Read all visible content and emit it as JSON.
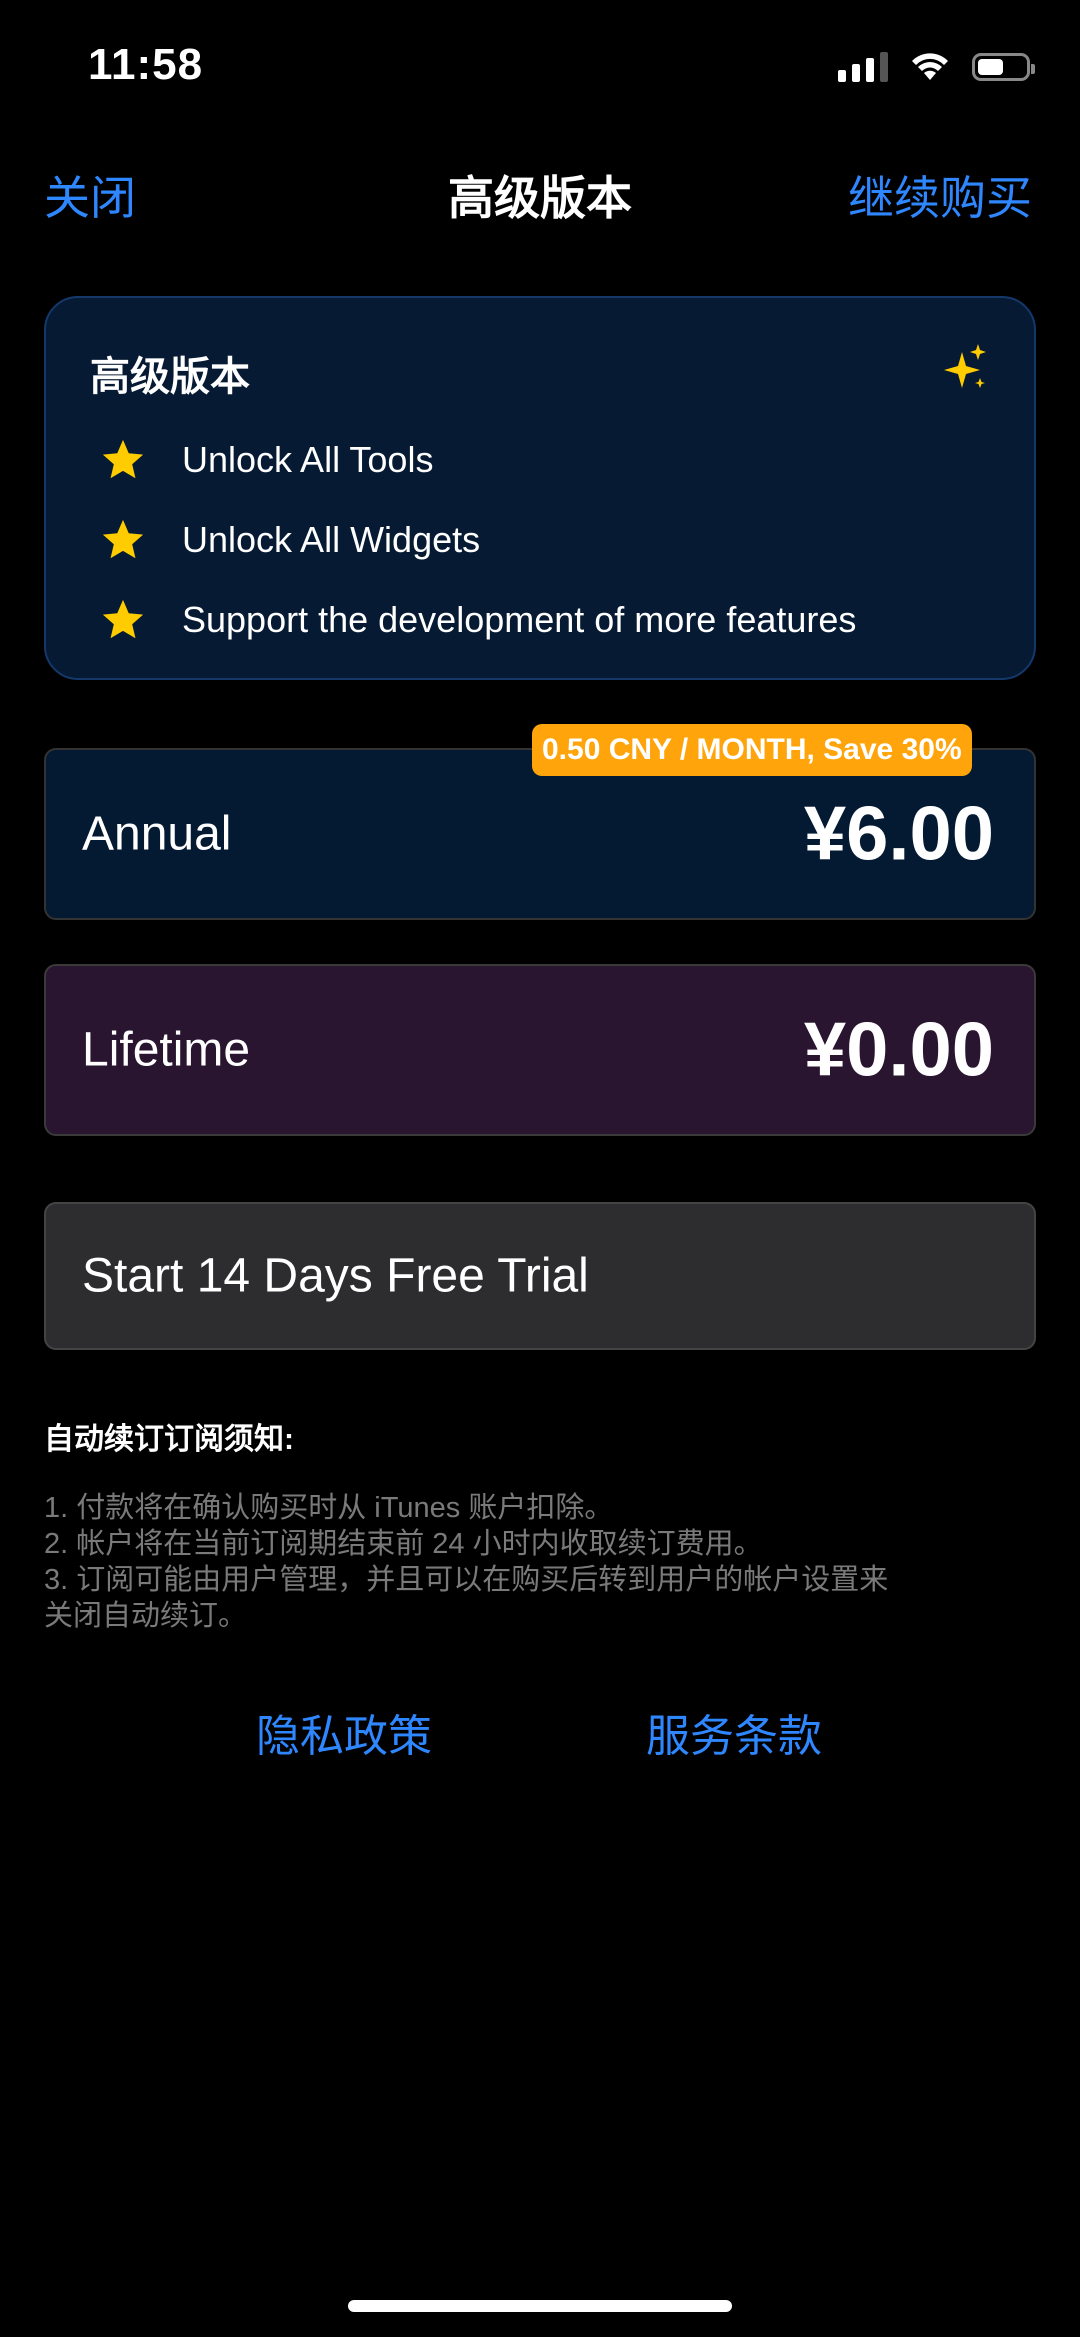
{
  "status_bar": {
    "time": "11:58",
    "battery_level": 0.55
  },
  "nav": {
    "close_label": "关闭",
    "title": "高级版本",
    "continue_label": "继续购买"
  },
  "premium_card": {
    "title": "高级版本",
    "features": [
      "Unlock All Tools",
      "Unlock All Widgets",
      "Support the development of more features"
    ]
  },
  "plans": {
    "annual": {
      "name": "Annual",
      "price": "¥6.00",
      "badge": "0.50 CNY / MONTH, Save 30%"
    },
    "lifetime": {
      "name": "Lifetime",
      "price": "¥0.00"
    }
  },
  "trial": {
    "label": "Start 14 Days Free Trial"
  },
  "notice": {
    "title": "自动续订订阅须知:",
    "lines": [
      "1. 付款将在确认购买时从 iTunes 账户扣除。",
      "2. 帐户将在当前订阅期结束前 24 小时内收取续订费用。",
      "3. 订阅可能由用户管理，并且可以在购买后转到用户的帐户设置来",
      "关闭自动续订。"
    ]
  },
  "footer": {
    "privacy_label": "隐私政策",
    "terms_label": "服务条款"
  },
  "colors": {
    "accent": "#2f87ff",
    "badge": "#ffa40a",
    "star": "#ffcc00"
  }
}
